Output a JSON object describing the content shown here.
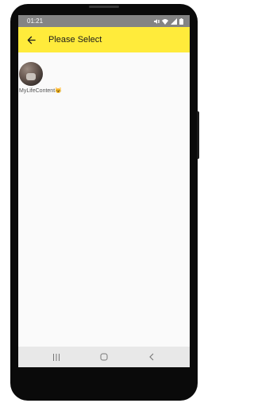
{
  "status_bar": {
    "time": "01:21",
    "icons": [
      "mute-icon",
      "wifi-icon",
      "signal-icon",
      "battery-icon"
    ]
  },
  "app_bar": {
    "title": "Please Select",
    "background": "#ffeb3b",
    "back_icon": "arrow-left-icon"
  },
  "profiles": [
    {
      "name": "MyLifeContent",
      "emoji": "😺"
    }
  ],
  "nav_bar": {
    "buttons": [
      "recent-apps",
      "home",
      "back"
    ]
  }
}
